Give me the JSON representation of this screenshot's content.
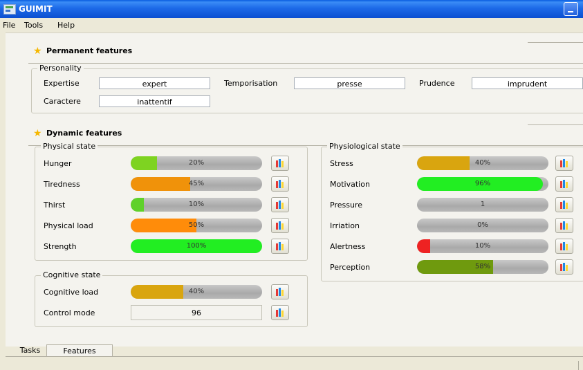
{
  "window": {
    "title": "GUIMIT"
  },
  "menu": [
    "File",
    "Tools",
    "Help"
  ],
  "permanent": {
    "title": "Permanent features",
    "personality": {
      "label": "Personality",
      "fields": [
        {
          "label": "Expertise",
          "value": "expert"
        },
        {
          "label": "Temporisation",
          "value": "presse"
        },
        {
          "label": "Prudence",
          "value": "imprudent"
        },
        {
          "label": "Caractere",
          "value": "inattentif"
        }
      ]
    }
  },
  "dynamic": {
    "title": "Dynamic features",
    "physical": {
      "label": "Physical state",
      "rows": [
        {
          "label": "Hunger",
          "value": 20,
          "text": "20%",
          "color": "#7ed321"
        },
        {
          "label": "Tiredness",
          "value": 45,
          "text": "45%",
          "color": "#f0920a"
        },
        {
          "label": "Thirst",
          "value": 10,
          "text": "10%",
          "color": "#5fd12a"
        },
        {
          "label": "Physical load",
          "value": 50,
          "text": "50%",
          "color": "#ff8c0a"
        },
        {
          "label": "Strength",
          "value": 100,
          "text": "100%",
          "color": "#22ee22"
        }
      ]
    },
    "cognitive": {
      "label": "Cognitive state",
      "load": {
        "label": "Cognitive load",
        "value": 40,
        "text": "40%",
        "color": "#d9a50f"
      },
      "control": {
        "label": "Control mode",
        "value": "96"
      }
    },
    "physiological": {
      "label": "Physiological state",
      "rows": [
        {
          "label": "Stress",
          "value": 40,
          "text": "40%",
          "color": "#d9a50f"
        },
        {
          "label": "Motivation",
          "value": 96,
          "text": "96%",
          "color": "#22ee22"
        },
        {
          "label": "Pressure",
          "value": 0,
          "text": "1",
          "color": "#d9a50f"
        },
        {
          "label": "Irriation",
          "value": 0,
          "text": "0%",
          "color": "#d9a50f"
        },
        {
          "label": "Alertness",
          "value": 10,
          "text": "10%",
          "color": "#ee2222"
        },
        {
          "label": "Perception",
          "value": 58,
          "text": "58%",
          "color": "#6f9a0e"
        }
      ]
    }
  },
  "tabs": [
    "Tasks",
    "Features"
  ],
  "active_tab": "Features"
}
